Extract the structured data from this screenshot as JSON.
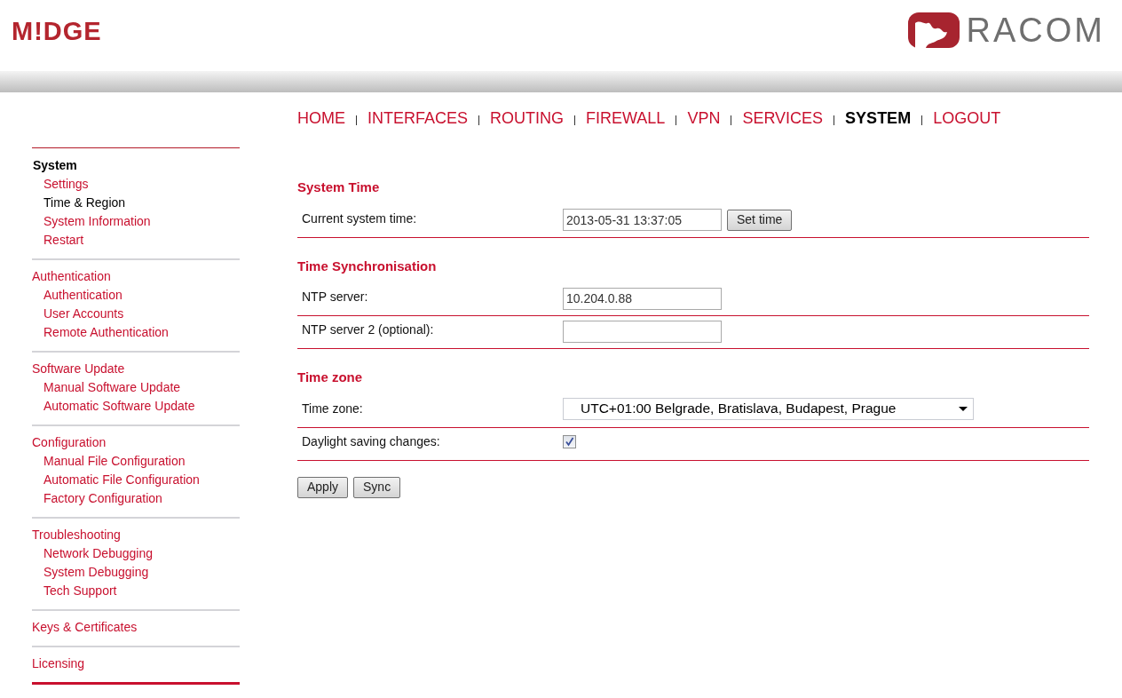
{
  "header": {
    "product_logo": "M!DGE",
    "company_logo": "RACOM"
  },
  "nav": [
    {
      "label": "HOME",
      "selected": false
    },
    {
      "label": "INTERFACES",
      "selected": false
    },
    {
      "label": "ROUTING",
      "selected": false
    },
    {
      "label": "FIREWALL",
      "selected": false
    },
    {
      "label": "VPN",
      "selected": false
    },
    {
      "label": "SERVICES",
      "selected": false
    },
    {
      "label": "SYSTEM",
      "selected": true
    },
    {
      "label": "LOGOUT",
      "selected": false
    }
  ],
  "sidebar": [
    {
      "title": "System",
      "selected": true,
      "items": [
        {
          "label": "Settings",
          "selected": false
        },
        {
          "label": "Time & Region",
          "selected": true
        },
        {
          "label": "System Information",
          "selected": false
        },
        {
          "label": "Restart",
          "selected": false
        }
      ]
    },
    {
      "title": "Authentication",
      "selected": false,
      "items": [
        {
          "label": "Authentication",
          "selected": false
        },
        {
          "label": "User Accounts",
          "selected": false
        },
        {
          "label": "Remote Authentication",
          "selected": false
        }
      ]
    },
    {
      "title": "Software Update",
      "selected": false,
      "items": [
        {
          "label": "Manual Software Update",
          "selected": false
        },
        {
          "label": "Automatic Software Update",
          "selected": false
        }
      ]
    },
    {
      "title": "Configuration",
      "selected": false,
      "items": [
        {
          "label": "Manual File Configuration",
          "selected": false
        },
        {
          "label": "Automatic File Configuration",
          "selected": false
        },
        {
          "label": "Factory Configuration",
          "selected": false
        }
      ]
    },
    {
      "title": "Troubleshooting",
      "selected": false,
      "items": [
        {
          "label": "Network Debugging",
          "selected": false
        },
        {
          "label": "System Debugging",
          "selected": false
        },
        {
          "label": "Tech Support",
          "selected": false
        }
      ]
    },
    {
      "title": "Keys & Certificates",
      "selected": false
    },
    {
      "title": "Licensing",
      "selected": false
    }
  ],
  "sections": [
    {
      "title": "System Time",
      "rows": [
        {
          "kind": "text",
          "label": "Current system time:",
          "value": "2013-05-31 13:37:05",
          "button": "Set time"
        }
      ]
    },
    {
      "title": "Time Synchronisation",
      "rows": [
        {
          "kind": "text",
          "label": "NTP server:",
          "value": "10.204.0.88"
        },
        {
          "kind": "text",
          "label": "NTP server 2 (optional):"
        }
      ]
    },
    {
      "title": "Time zone",
      "rows": [
        {
          "kind": "select",
          "label": "Time zone:",
          "value": "UTC+01:00 Belgrade, Bratislava, Budapest, Prague"
        },
        {
          "kind": "checkbox",
          "label": "Daylight saving changes:",
          "checked": true
        }
      ]
    }
  ],
  "buttons": [
    "Apply",
    "Sync"
  ]
}
